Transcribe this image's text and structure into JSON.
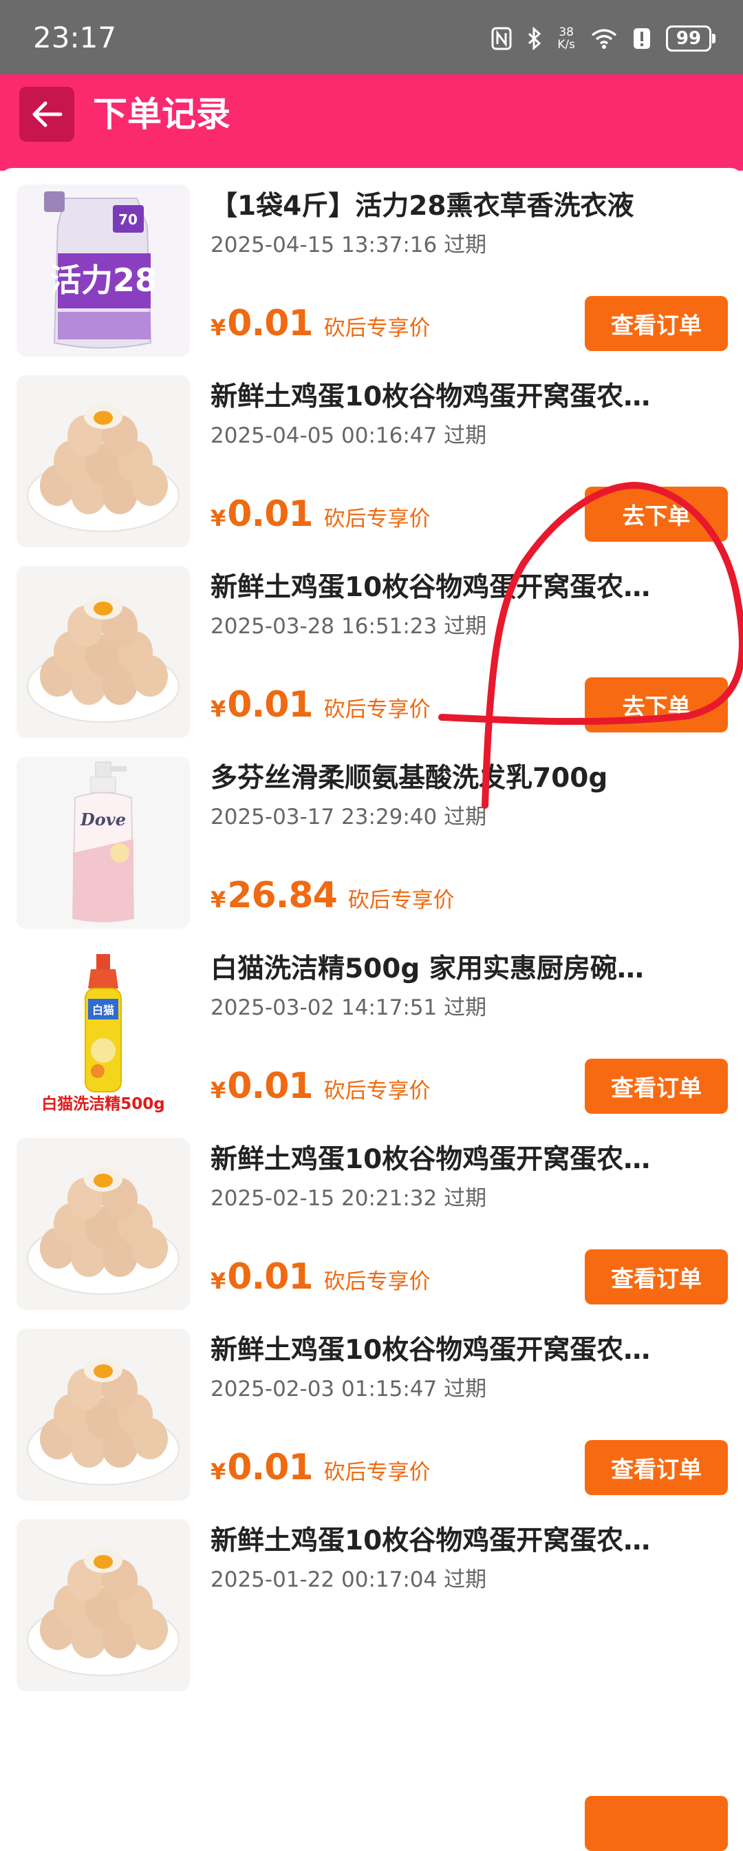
{
  "status_bar": {
    "time": "23:17",
    "net_speed_value": "38",
    "net_speed_unit": "K/s",
    "battery": "99",
    "icons": [
      "nfc-icon",
      "bluetooth-icon",
      "wifi-icon",
      "alert-icon",
      "battery-icon"
    ]
  },
  "header": {
    "title": "下单记录",
    "back_icon": "back-arrow-icon"
  },
  "colors": {
    "header_bg": "#fb2a6f",
    "accent": "#f86a11",
    "price": "#ef6a10",
    "annotation_stroke": "#e8192c"
  },
  "orders": [
    {
      "title": "【1袋4斤】活力28熏衣草香洗衣液",
      "meta": "2025-04-15 13:37:16 过期",
      "currency": "¥",
      "price": "0.01",
      "price_tag": "砍后专享价",
      "action": "查看订单",
      "image": "laundry-detergent-bag",
      "image_caption": ""
    },
    {
      "title": "新鲜土鸡蛋10枚谷物鸡蛋开窝蛋农…",
      "meta": "2025-04-05 00:16:47 过期",
      "currency": "¥",
      "price": "0.01",
      "price_tag": "砍后专享价",
      "action": "去下单",
      "image": "eggs-plate",
      "image_caption": ""
    },
    {
      "title": "新鲜土鸡蛋10枚谷物鸡蛋开窝蛋农…",
      "meta": "2025-03-28 16:51:23 过期",
      "currency": "¥",
      "price": "0.01",
      "price_tag": "砍后专享价",
      "action": "去下单",
      "image": "eggs-plate",
      "image_caption": ""
    },
    {
      "title": "多芬丝滑柔顺氨基酸洗发乳700g",
      "meta": "2025-03-17 23:29:40 过期",
      "currency": "¥",
      "price": "26.84",
      "price_tag": "砍后专享价",
      "action": "",
      "image": "shampoo-bottle",
      "image_caption": ""
    },
    {
      "title": "白猫洗洁精500g 家用实惠厨房碗…",
      "meta": "2025-03-02 14:17:51 过期",
      "currency": "¥",
      "price": "0.01",
      "price_tag": "砍后专享价",
      "action": "查看订单",
      "image": "dish-soap-bottle",
      "image_caption": "白猫洗洁精500g"
    },
    {
      "title": "新鲜土鸡蛋10枚谷物鸡蛋开窝蛋农…",
      "meta": "2025-02-15 20:21:32 过期",
      "currency": "¥",
      "price": "0.01",
      "price_tag": "砍后专享价",
      "action": "查看订单",
      "image": "eggs-plate",
      "image_caption": ""
    },
    {
      "title": "新鲜土鸡蛋10枚谷物鸡蛋开窝蛋农…",
      "meta": "2025-02-03 01:15:47 过期",
      "currency": "¥",
      "price": "0.01",
      "price_tag": "砍后专享价",
      "action": "查看订单",
      "image": "eggs-plate",
      "image_caption": ""
    },
    {
      "title": "新鲜土鸡蛋10枚谷物鸡蛋开窝蛋农…",
      "meta": "2025-01-22 00:17:04 过期",
      "currency": "¥",
      "price": "",
      "price_tag": "",
      "action": "",
      "image": "eggs-plate",
      "image_caption": ""
    }
  ]
}
